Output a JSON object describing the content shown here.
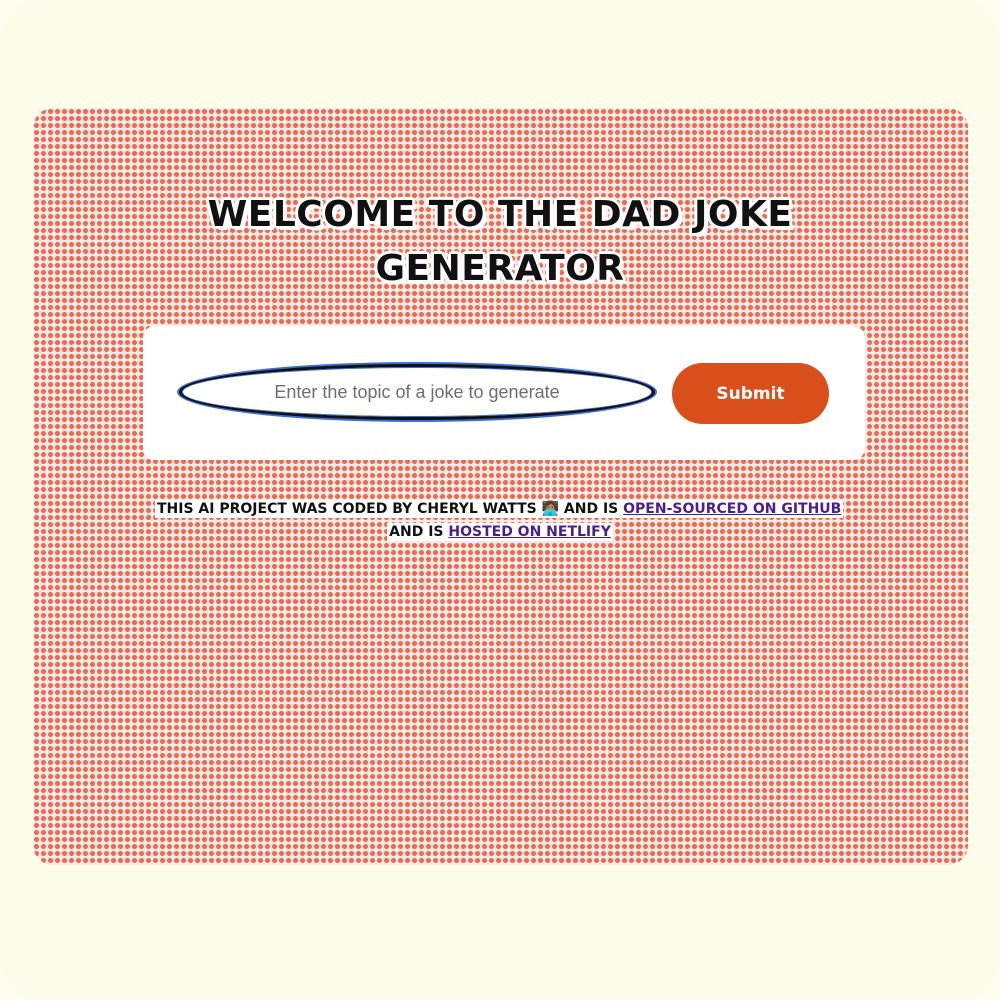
{
  "header": {
    "title_line1": "WELCOME TO THE DAD JOKE",
    "title_line2": "GENERATOR"
  },
  "form": {
    "input_placeholder": "Enter the topic of a joke to generate",
    "input_value": "",
    "submit_label": "Submit"
  },
  "footer": {
    "text_part1": "THIS AI PROJECT WAS CODED BY CHERYL WATTS",
    "emoji": "👩🏽‍💻",
    "text_part2": "AND IS",
    "link_github": "OPEN-SOURCED ON GITHUB",
    "text_part3": "AND IS",
    "link_netlify": "HOSTED ON NETLIFY"
  },
  "colors": {
    "page_background": "#fdfdec",
    "halftone_dot": "#ec6a52",
    "submit_button": "#d94f1b",
    "link": "#4b1d8f",
    "input_focus_ring": "#3b6fd6"
  }
}
